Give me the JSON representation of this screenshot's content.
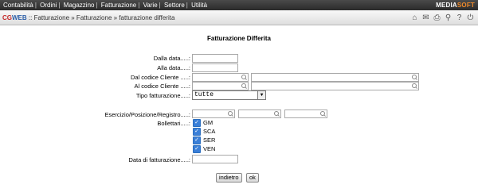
{
  "menubar": {
    "items": [
      "Contabilità",
      "Ordini",
      "Magazzino",
      "Fatturazione",
      "Varie",
      "Settore",
      "Utilità"
    ],
    "brand_part1": "MEDIA",
    "brand_part2": "SOFT"
  },
  "titlebar": {
    "logo_part1": "CG",
    "logo_part2": "WEB",
    "path": " :: Fatturazione » Fatturazione » fatturazione differita",
    "icons": [
      "home-icon",
      "mail-icon",
      "print-icon",
      "search-icon",
      "help-icon",
      "power-icon"
    ]
  },
  "page": {
    "title": "Fatturazione Differita"
  },
  "form": {
    "dalla_data_label": "Dalla data.....:",
    "alla_data_label": "Alla data.....:",
    "dal_cliente_label": "Dal codice Cliente .....:",
    "al_cliente_label": "Al codice Cliente .....:",
    "tipo_label": "Tipo fatturazione.....:",
    "tipo_value": "tutte",
    "esercizio_label": "Esercizio/Posizione/Registro.....:",
    "bollettari_label": "Bollettari.....:",
    "bollettari": [
      {
        "label": "GM",
        "checked": true
      },
      {
        "label": "SCA",
        "checked": true
      },
      {
        "label": "SER",
        "checked": true
      },
      {
        "label": "VEN",
        "checked": true
      }
    ],
    "data_fatt_label": "Data di fatturazione.....:"
  },
  "buttons": {
    "back": "indietro",
    "ok": "ok"
  }
}
